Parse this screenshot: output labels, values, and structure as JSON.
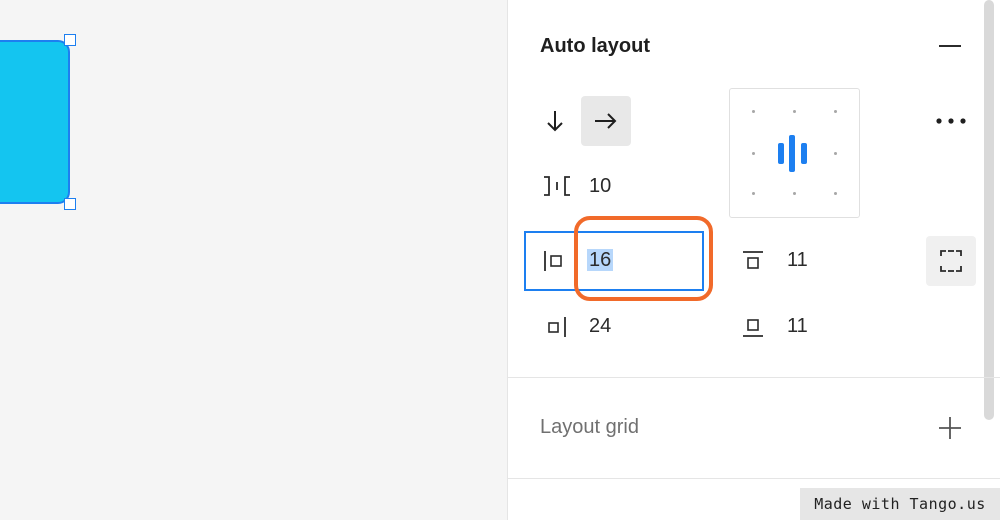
{
  "canvas": {
    "shape_color": "#14c5f0",
    "selection_color": "#1d7ff0"
  },
  "auto_layout": {
    "title": "Auto layout",
    "collapse_icon": "minus-icon",
    "direction_vertical_icon": "arrow-down-icon",
    "direction_horizontal_icon": "arrow-right-icon",
    "active_direction": "horizontal",
    "spacing_between": "10",
    "padding_left": "16",
    "padding_top": "11",
    "padding_right": "24",
    "padding_bottom": "11",
    "alignment": "center-left",
    "more_icon": "more-horizontal-icon",
    "clip_icon": "clip-content-icon"
  },
  "layout_grid": {
    "title": "Layout grid",
    "add_icon": "plus-icon"
  },
  "highlight_color": "#f16a2a",
  "watermark": {
    "text": "Made with Tango.us"
  }
}
